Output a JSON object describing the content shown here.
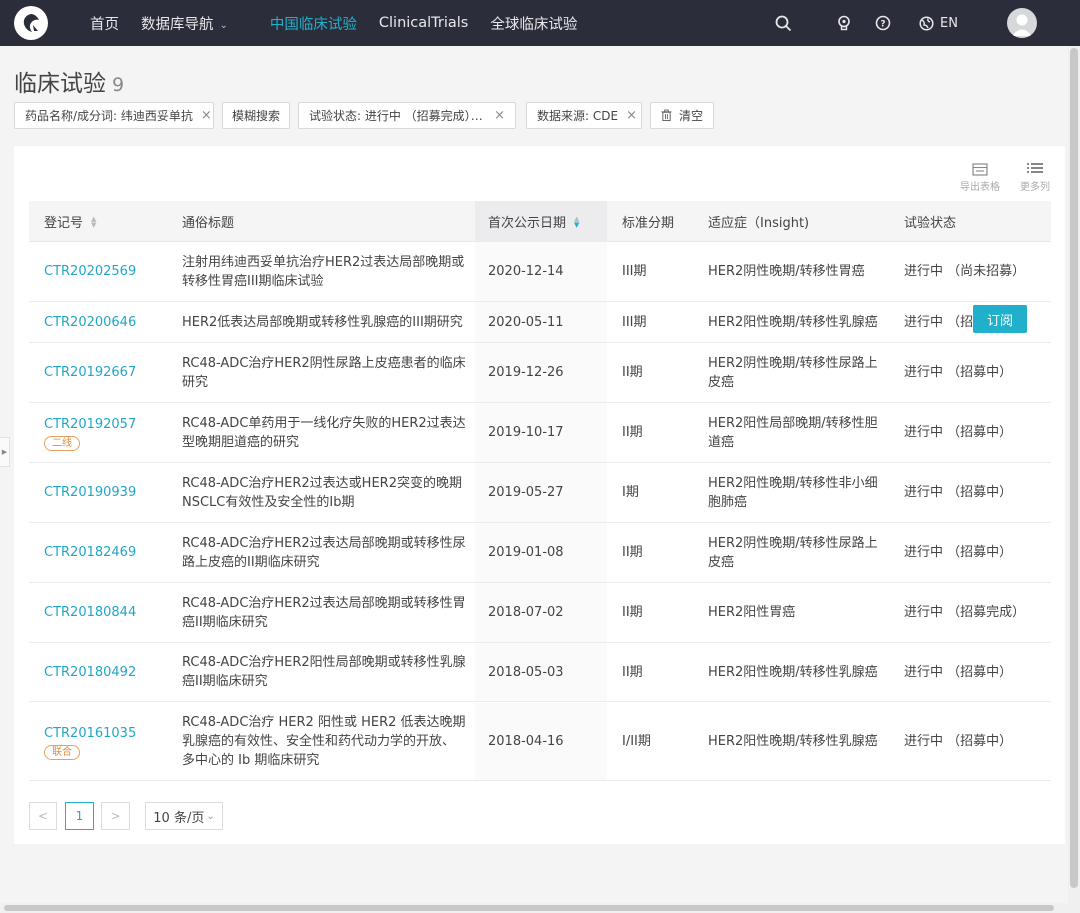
{
  "nav": {
    "items": [
      "首页",
      "数据库导航",
      "中国临床试验",
      "ClinicalTrials",
      "全球临床试验"
    ],
    "active_index": 2,
    "lang": "EN"
  },
  "page": {
    "title": "临床试验",
    "count": "9"
  },
  "filters": {
    "chip1": "药品名称/成分词: 纬迪西妥单抗",
    "chip2": "模糊搜索",
    "chip3": "试验状态: 进行中 （招募完成），...",
    "chip4": "数据来源: CDE",
    "clear": "清空"
  },
  "toolbar": {
    "export": "导出表格",
    "more_cols": "更多列"
  },
  "table": {
    "headers": [
      "登记号",
      "通俗标题",
      "首次公示日期",
      "标准分期",
      "适应症（Insight)",
      "试验状态"
    ],
    "rows": [
      {
        "id": "CTR20202569",
        "tag": "",
        "title": "注射用纬迪西妥单抗治疗HER2过表达局部晚期或转移性胃癌III期临床试验",
        "date": "2020-12-14",
        "phase": "III期",
        "indication": "HER2阴性晚期/转移性胃癌",
        "status": "进行中 （尚未招募）"
      },
      {
        "id": "CTR20200646",
        "tag": "",
        "title": "HER2低表达局部晚期或转移性乳腺癌的III期研究",
        "date": "2020-05-11",
        "phase": "III期",
        "indication": "HER2阳性晚期/转移性乳腺癌",
        "status": "进行中 （招募中）"
      },
      {
        "id": "CTR20192667",
        "tag": "",
        "title": "RC48-ADC治疗HER2阴性尿路上皮癌患者的临床研究",
        "date": "2019-12-26",
        "phase": "II期",
        "indication": "HER2阴性晚期/转移性尿路上皮癌",
        "status": "进行中 （招募中）"
      },
      {
        "id": "CTR20192057",
        "tag": "二线",
        "title": "RC48-ADC单药用于一线化疗失败的HER2过表达型晚期胆道癌的研究",
        "date": "2019-10-17",
        "phase": "II期",
        "indication": "HER2阳性局部晚期/转移性胆道癌",
        "status": "进行中 （招募中）"
      },
      {
        "id": "CTR20190939",
        "tag": "",
        "title": "RC48-ADC治疗HER2过表达或HER2突变的晚期NSCLC有效性及安全性的Ib期",
        "date": "2019-05-27",
        "phase": "I期",
        "indication": "HER2阳性晚期/转移性非小细胞肺癌",
        "status": "进行中 （招募中）"
      },
      {
        "id": "CTR20182469",
        "tag": "",
        "title": "RC48-ADC治疗HER2过表达局部晚期或转移性尿路上皮癌的II期临床研究",
        "date": "2019-01-08",
        "phase": "II期",
        "indication": "HER2阴性晚期/转移性尿路上皮癌",
        "status": "进行中 （招募中）"
      },
      {
        "id": "CTR20180844",
        "tag": "",
        "title": "RC48-ADC治疗HER2过表达局部晚期或转移性胃癌II期临床研究",
        "date": "2018-07-02",
        "phase": "II期",
        "indication": "HER2阳性胃癌",
        "status": "进行中 （招募完成）"
      },
      {
        "id": "CTR20180492",
        "tag": "",
        "title": "RC48-ADC治疗HER2阳性局部晚期或转移性乳腺癌II期临床研究",
        "date": "2018-05-03",
        "phase": "II期",
        "indication": "HER2阳性晚期/转移性乳腺癌",
        "status": "进行中 （招募中）"
      },
      {
        "id": "CTR20161035",
        "tag": "联合",
        "title": "RC48-ADC治疗 HER2 阳性或 HER2 低表达晚期乳腺癌的有效性、安全性和药代动力学的开放、多中心的 Ib 期临床研究",
        "date": "2018-04-16",
        "phase": "I/II期",
        "indication": "HER2阳性晚期/转移性乳腺癌",
        "status": "进行中 （招募中）"
      }
    ]
  },
  "subscribe_label": "订阅",
  "pagination": {
    "current": "1",
    "page_size": "10 条/页"
  },
  "colors": {
    "nav_bg": "#2b2e3a",
    "accent": "#21b0cc",
    "link": "#21a6c8",
    "tag": "#e08a3c"
  }
}
